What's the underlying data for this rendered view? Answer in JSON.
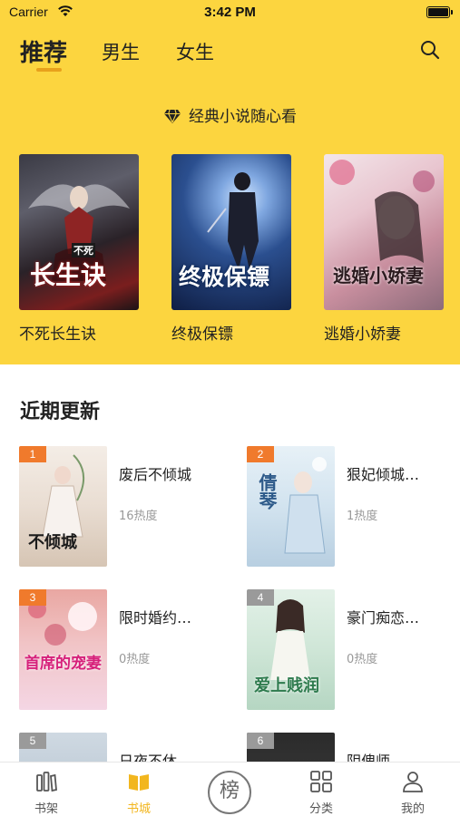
{
  "status_bar": {
    "carrier": "Carrier",
    "time": "3:42 PM"
  },
  "header": {
    "tabs": [
      {
        "label": "推荐",
        "active": true
      },
      {
        "label": "男生",
        "active": false
      },
      {
        "label": "女生",
        "active": false
      }
    ],
    "search_icon": "search-icon",
    "accent_color": "#FCD53F"
  },
  "slogan": {
    "icon": "diamond-icon",
    "text": "经典小说随心看"
  },
  "featured": [
    {
      "title": "不死长生诀",
      "cover_text": "长生诀",
      "cover_top": "不死"
    },
    {
      "title": "终极保镖",
      "cover_text": "终极保镖"
    },
    {
      "title": "逃婚小娇妻",
      "cover_text": "逃婚小娇妻"
    }
  ],
  "recent": {
    "title": "近期更新",
    "books": [
      {
        "rank": "1",
        "title": "废后不倾城",
        "heat": "16热度",
        "cover_text": "不倾城"
      },
      {
        "rank": "2",
        "title": "狠妃倾城…",
        "heat": "1热度",
        "cover_text": "倩琴"
      },
      {
        "rank": "3",
        "title": "限时婚约…",
        "heat": "0热度",
        "cover_text": "首席的宠妻"
      },
      {
        "rank": "4",
        "title": "豪门痴恋…",
        "heat": "0热度",
        "cover_text": "爱上贱润"
      },
      {
        "rank": "5",
        "title": "日夜不休…",
        "heat": ""
      },
      {
        "rank": "6",
        "title": "阴傀师",
        "heat": ""
      }
    ]
  },
  "tabbar": {
    "items": [
      {
        "label": "书架",
        "icon": "bookshelf-icon",
        "active": false
      },
      {
        "label": "书城",
        "icon": "bookstore-icon",
        "active": true
      },
      {
        "label": "榜",
        "icon": "ranking-icon",
        "active": false
      },
      {
        "label": "分类",
        "icon": "category-icon",
        "active": false
      },
      {
        "label": "我的",
        "icon": "profile-icon",
        "active": false
      }
    ],
    "active_color": "#F2B61E"
  }
}
